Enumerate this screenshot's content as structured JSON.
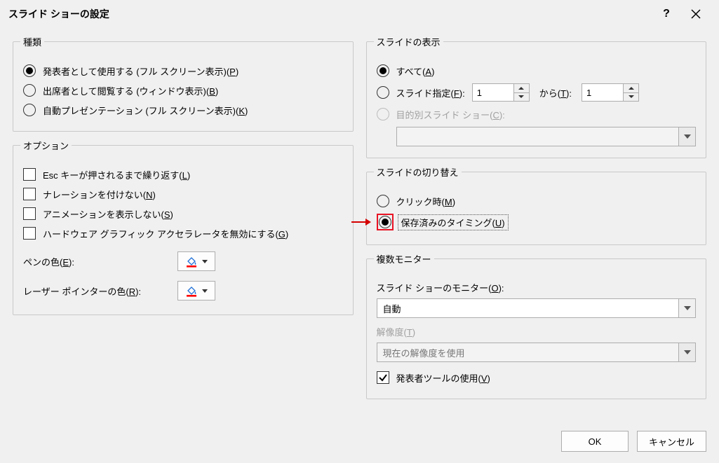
{
  "title": "スライド ショーの設定",
  "groups": {
    "type": {
      "legend": "種類",
      "presenter": {
        "label": "発表者として使用する (フル スクリーン表示)(",
        "key": "P",
        "tail": ")"
      },
      "browse": {
        "label": "出席者として閲覧する (ウィンドウ表示)(",
        "key": "B",
        "tail": ")"
      },
      "kiosk": {
        "label": "自動プレゼンテーション (フル スクリーン表示)(",
        "key": "K",
        "tail": ")"
      }
    },
    "options": {
      "legend": "オプション",
      "loop": {
        "label": "Esc キーが押されるまで繰り返す(",
        "key": "L",
        "tail": ")"
      },
      "narration": {
        "label": "ナレーションを付けない(",
        "key": "N",
        "tail": ")"
      },
      "animation": {
        "label": "アニメーションを表示しない(",
        "key": "S",
        "tail": ")"
      },
      "hwgfx": {
        "label": "ハードウェア グラフィック アクセラレータを無効にする(",
        "key": "G",
        "tail": ")"
      },
      "pen": {
        "label": "ペンの色(",
        "key": "E",
        "tail": "):"
      },
      "laser": {
        "label": "レーザー ポインターの色(",
        "key": "R",
        "tail": "):"
      }
    },
    "show": {
      "legend": "スライドの表示",
      "all": {
        "label": "すべて(",
        "key": "A",
        "tail": ")"
      },
      "range": {
        "label": "スライド指定(",
        "key": "F",
        "tail": "):",
        "from_value": "1",
        "to_label": "から(",
        "to_key": "T",
        "to_tail": "):",
        "to_value": "1"
      },
      "custom": {
        "label": "目的別スライド ショー(",
        "key": "C",
        "tail": "):"
      }
    },
    "advance": {
      "legend": "スライドの切り替え",
      "manual": {
        "label": "クリック時(",
        "key": "M",
        "tail": ")"
      },
      "timings": {
        "label": "保存済みのタイミング(",
        "key": "U",
        "tail": ")"
      }
    },
    "monitors": {
      "legend": "複数モニター",
      "monitor_label": {
        "label": "スライド ショーのモニター(",
        "key": "O",
        "tail": "):"
      },
      "monitor_value": "自動",
      "resolution_label": {
        "label": "解像度(",
        "key": "T",
        "tail": ")"
      },
      "resolution_value": "現在の解像度を使用",
      "presenter_view": {
        "label": "発表者ツールの使用(",
        "key": "V",
        "tail": ")"
      }
    }
  },
  "buttons": {
    "ok": "OK",
    "cancel": "キャンセル"
  },
  "colors": {
    "pen": "#ff0000",
    "laser": "#ff0000"
  }
}
